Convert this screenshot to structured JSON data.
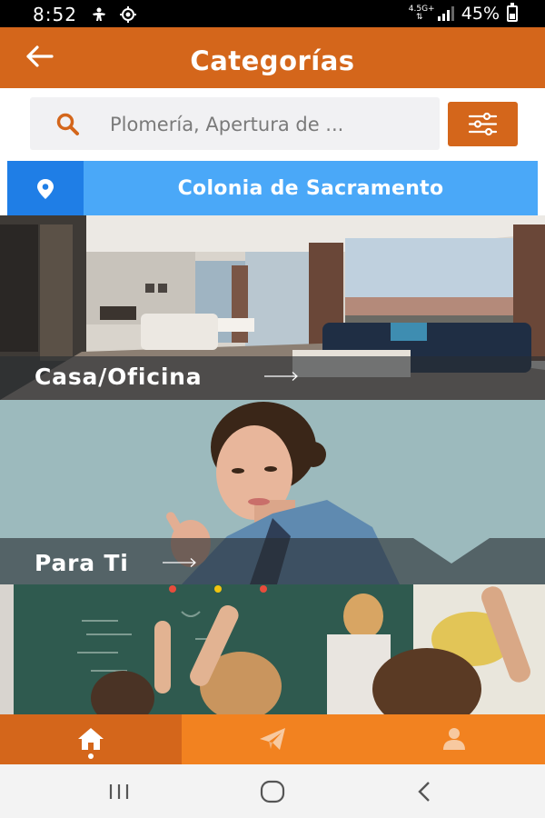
{
  "status_bar": {
    "time": "8:52",
    "network": "4.5G+",
    "battery": "45%",
    "battery_level": 0.45,
    "icons": [
      "accessibility-icon",
      "location-target-icon",
      "network-icon",
      "signal-icon",
      "battery-icon"
    ]
  },
  "header": {
    "title": "Categorías",
    "back_icon": "arrow-left-icon"
  },
  "search": {
    "placeholder": "Plomería, Apertura de ...",
    "search_icon": "search-icon",
    "filter_icon": "sliders-icon"
  },
  "location": {
    "label": "Colonia de Sacramento",
    "icon": "map-pin-icon"
  },
  "categories": [
    {
      "label": "Casa/Oficina",
      "image": "living-room-photo",
      "arrow_icon": "long-arrow-right-icon"
    },
    {
      "label": "Para Ti",
      "image": "woman-portrait-photo",
      "arrow_icon": "long-arrow-right-icon"
    },
    {
      "label": "",
      "image": "classroom-photo"
    }
  ],
  "bottom_nav": {
    "items": [
      {
        "name": "home",
        "icon": "home-icon",
        "active": true
      },
      {
        "name": "send",
        "icon": "paper-plane-icon",
        "active": false
      },
      {
        "name": "profile",
        "icon": "user-icon",
        "active": false
      }
    ]
  },
  "system_nav": {
    "icons": [
      "recent-apps-icon",
      "home-circle-icon",
      "back-chevron-icon"
    ]
  },
  "colors": {
    "primary_orange": "#d4661b",
    "nav_orange": "#f28220",
    "location_blue": "#4aa8f8",
    "location_dark_blue": "#1f7ee6"
  }
}
